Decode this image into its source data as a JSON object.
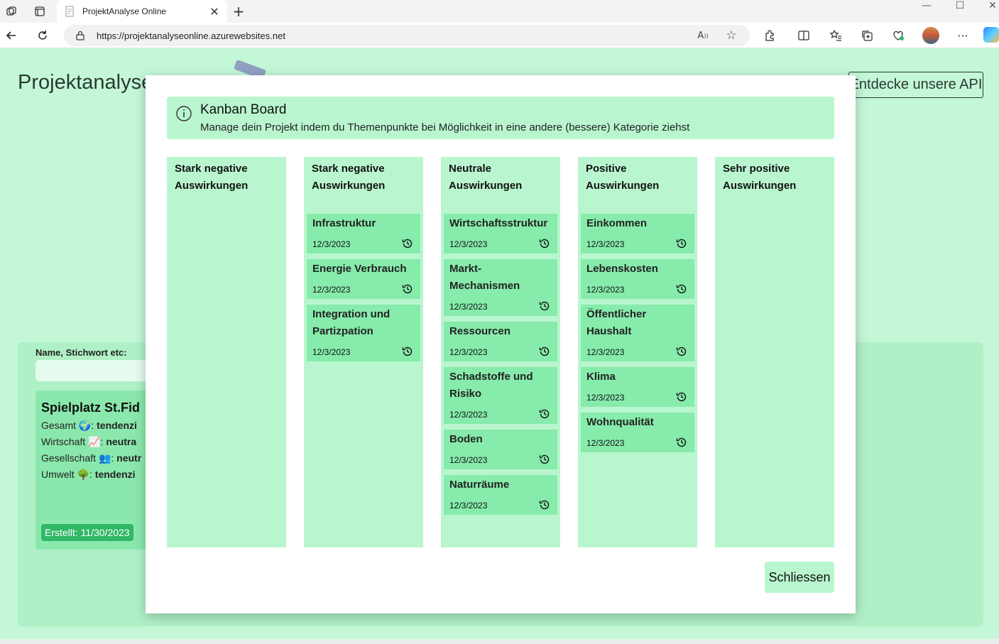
{
  "browser": {
    "tab_title": "ProjektAnalyse Online",
    "url": "https://projektanalyseonline.azurewebsites.net"
  },
  "page": {
    "site_title": "Projektanalyse",
    "api_button": "Entdecke unsere API",
    "search_label": "Name, Stichwort etc:",
    "project_card": {
      "title": "Spielplatz St.Fid",
      "lines": [
        {
          "label": "Gesamt",
          "icon": "globe-icon",
          "value": "tendenzi"
        },
        {
          "label": "Wirtschaft",
          "icon": "chart-up-icon",
          "value": "neutra"
        },
        {
          "label": "Gesellschaft",
          "icon": "people-icon",
          "value": "neutr"
        },
        {
          "label": "Umwelt",
          "icon": "tree-icon",
          "value": "tendenzi"
        }
      ],
      "created": "Erstellt: 11/30/2023"
    }
  },
  "modal": {
    "title": "Kanban Board",
    "description": "Manage dein Projekt indem du Themenpunkte bei Möglichkeit in eine andere (bessere) Kategorie ziehst",
    "close_label": "Schliessen",
    "columns": [
      {
        "title": "Stark negative Auswirkungen",
        "cards": []
      },
      {
        "title": "Stark negative Auswirkungen",
        "cards": [
          {
            "title": "Infrastruktur",
            "date": "12/3/2023"
          },
          {
            "title": "Energie Verbrauch",
            "date": "12/3/2023"
          },
          {
            "title": "Integration und Partizpation",
            "date": "12/3/2023"
          }
        ]
      },
      {
        "title": "Neutrale Auswirkungen",
        "cards": [
          {
            "title": "Wirtschaftsstruktur",
            "date": "12/3/2023"
          },
          {
            "title": "Markt-Mechanismen",
            "date": "12/3/2023"
          },
          {
            "title": "Ressourcen",
            "date": "12/3/2023"
          },
          {
            "title": "Schadstoffe und Risiko",
            "date": "12/3/2023"
          },
          {
            "title": "Boden",
            "date": "12/3/2023"
          },
          {
            "title": "Naturräume",
            "date": "12/3/2023"
          }
        ]
      },
      {
        "title": "Positive Auswirkungen",
        "cards": [
          {
            "title": "Einkommen",
            "date": "12/3/2023"
          },
          {
            "title": "Lebenskosten",
            "date": "12/3/2023"
          },
          {
            "title": "Öffentlicher Haushalt",
            "date": "12/3/2023"
          },
          {
            "title": "Klima",
            "date": "12/3/2023"
          },
          {
            "title": "Wohnqualität",
            "date": "12/3/2023"
          }
        ]
      },
      {
        "title": "Sehr positive Auswirkungen",
        "cards": []
      }
    ]
  },
  "colors": {
    "page_bg": "#c3f7d7",
    "column_bg": "#b9f6cf",
    "card_bg": "#86ebab",
    "badge_bg": "#2fb866"
  }
}
